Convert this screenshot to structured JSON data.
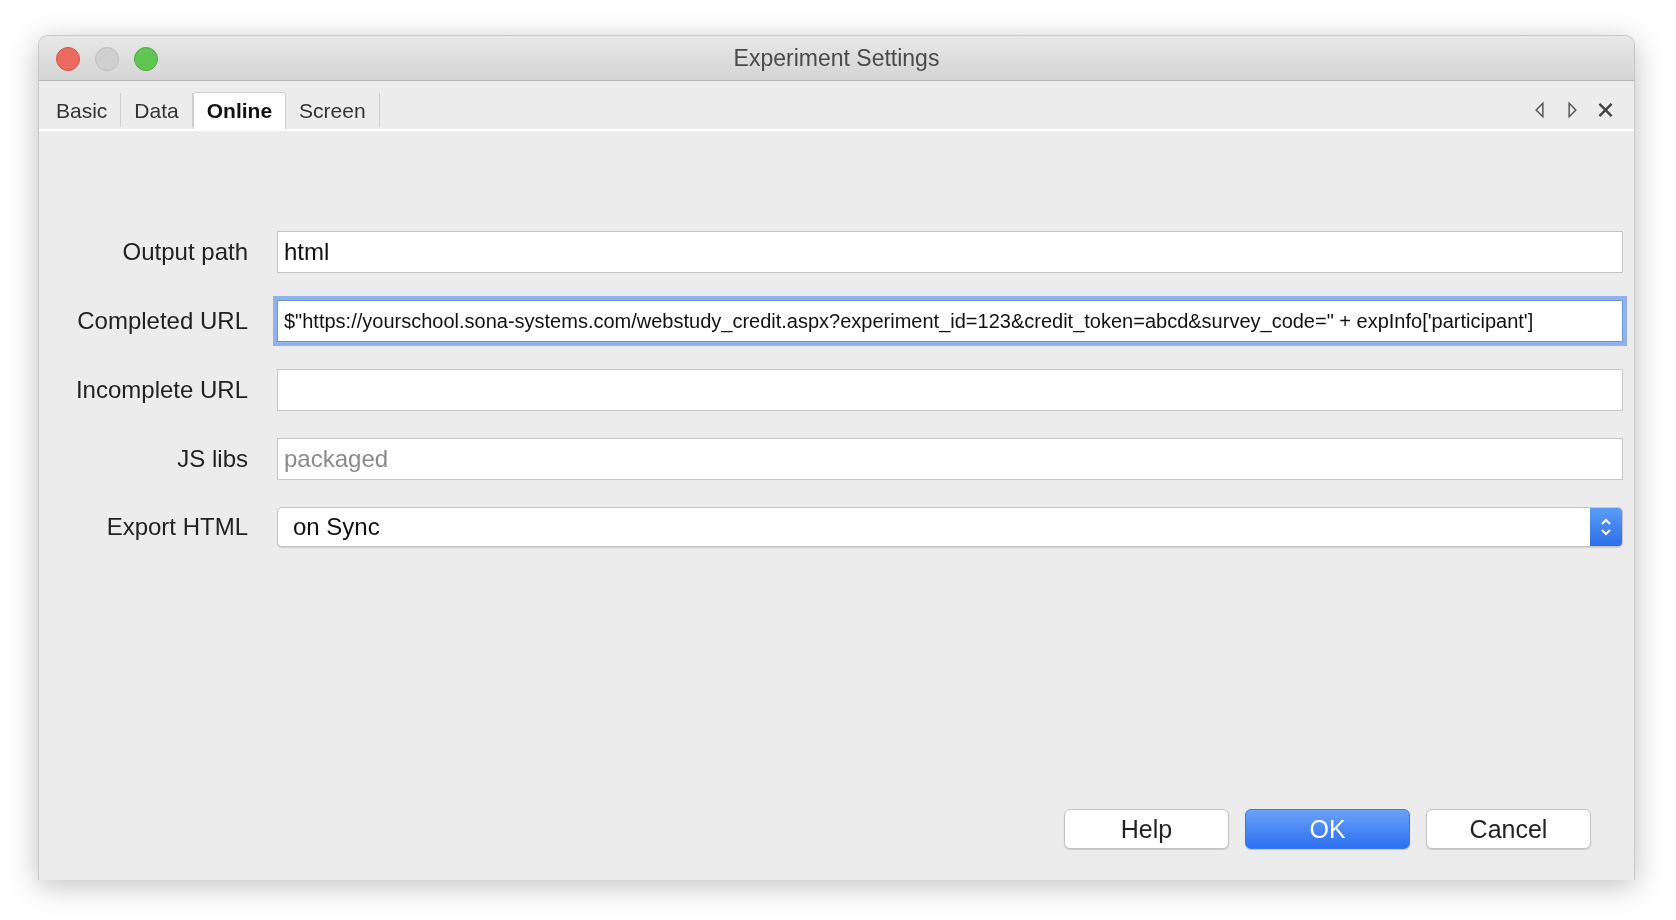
{
  "window": {
    "title": "Experiment Settings"
  },
  "tabs": [
    {
      "label": "Basic",
      "selected": false
    },
    {
      "label": "Data",
      "selected": false
    },
    {
      "label": "Online",
      "selected": true
    },
    {
      "label": "Screen",
      "selected": false
    }
  ],
  "fields": [
    {
      "label": "Output path",
      "kind": "text",
      "value": "html",
      "focused": false
    },
    {
      "label": "Completed URL",
      "kind": "text",
      "value": "$\"https://yourschool.sona-systems.com/webstudy_credit.aspx?experiment_id=123&credit_token=abcd&survey_code=\" + expInfo['participant']",
      "focused": true
    },
    {
      "label": "Incomplete URL",
      "kind": "text",
      "focused": false
    },
    {
      "label": "JS libs",
      "kind": "text",
      "placeholder": "packaged",
      "focused": false
    },
    {
      "label": "Export HTML",
      "kind": "select",
      "value": "on Sync",
      "focused": false
    }
  ],
  "buttons": [
    {
      "label": "Help",
      "kind": "default"
    },
    {
      "label": "OK",
      "kind": "primary"
    },
    {
      "label": "Cancel",
      "kind": "default"
    }
  ]
}
